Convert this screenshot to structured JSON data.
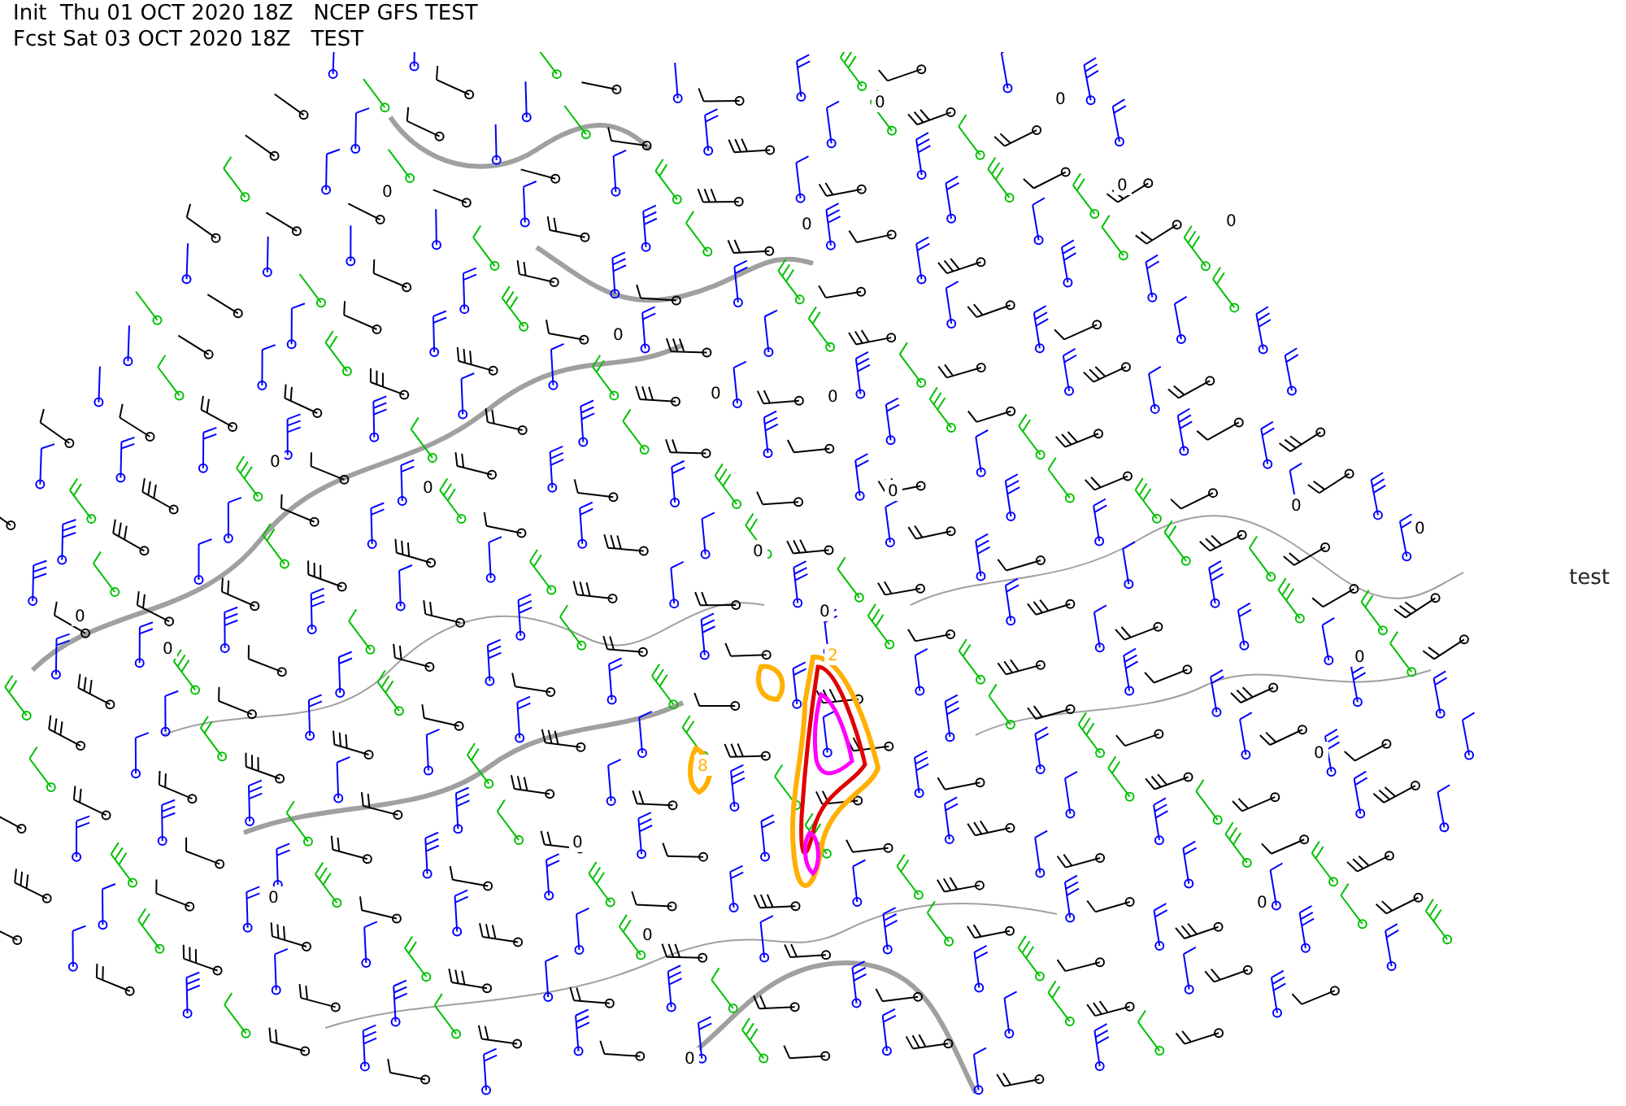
{
  "header": {
    "init_line": "Init  Thu 01 OCT 2020 18Z   NCEP GFS TEST",
    "forecast_line": "Fcst Sat 03 OCT 2020 18Z   TEST"
  },
  "map": {
    "contour_labels": [
      "0",
      "0",
      "0",
      "0",
      "0",
      "0",
      "0",
      "0",
      "0",
      "0",
      "0",
      "0",
      "0",
      "0",
      "0",
      "0",
      "0",
      "0",
      "0",
      "0",
      "0",
      "0",
      "0",
      "0",
      "0",
      "2",
      "8"
    ]
  },
  "side_label": "test"
}
